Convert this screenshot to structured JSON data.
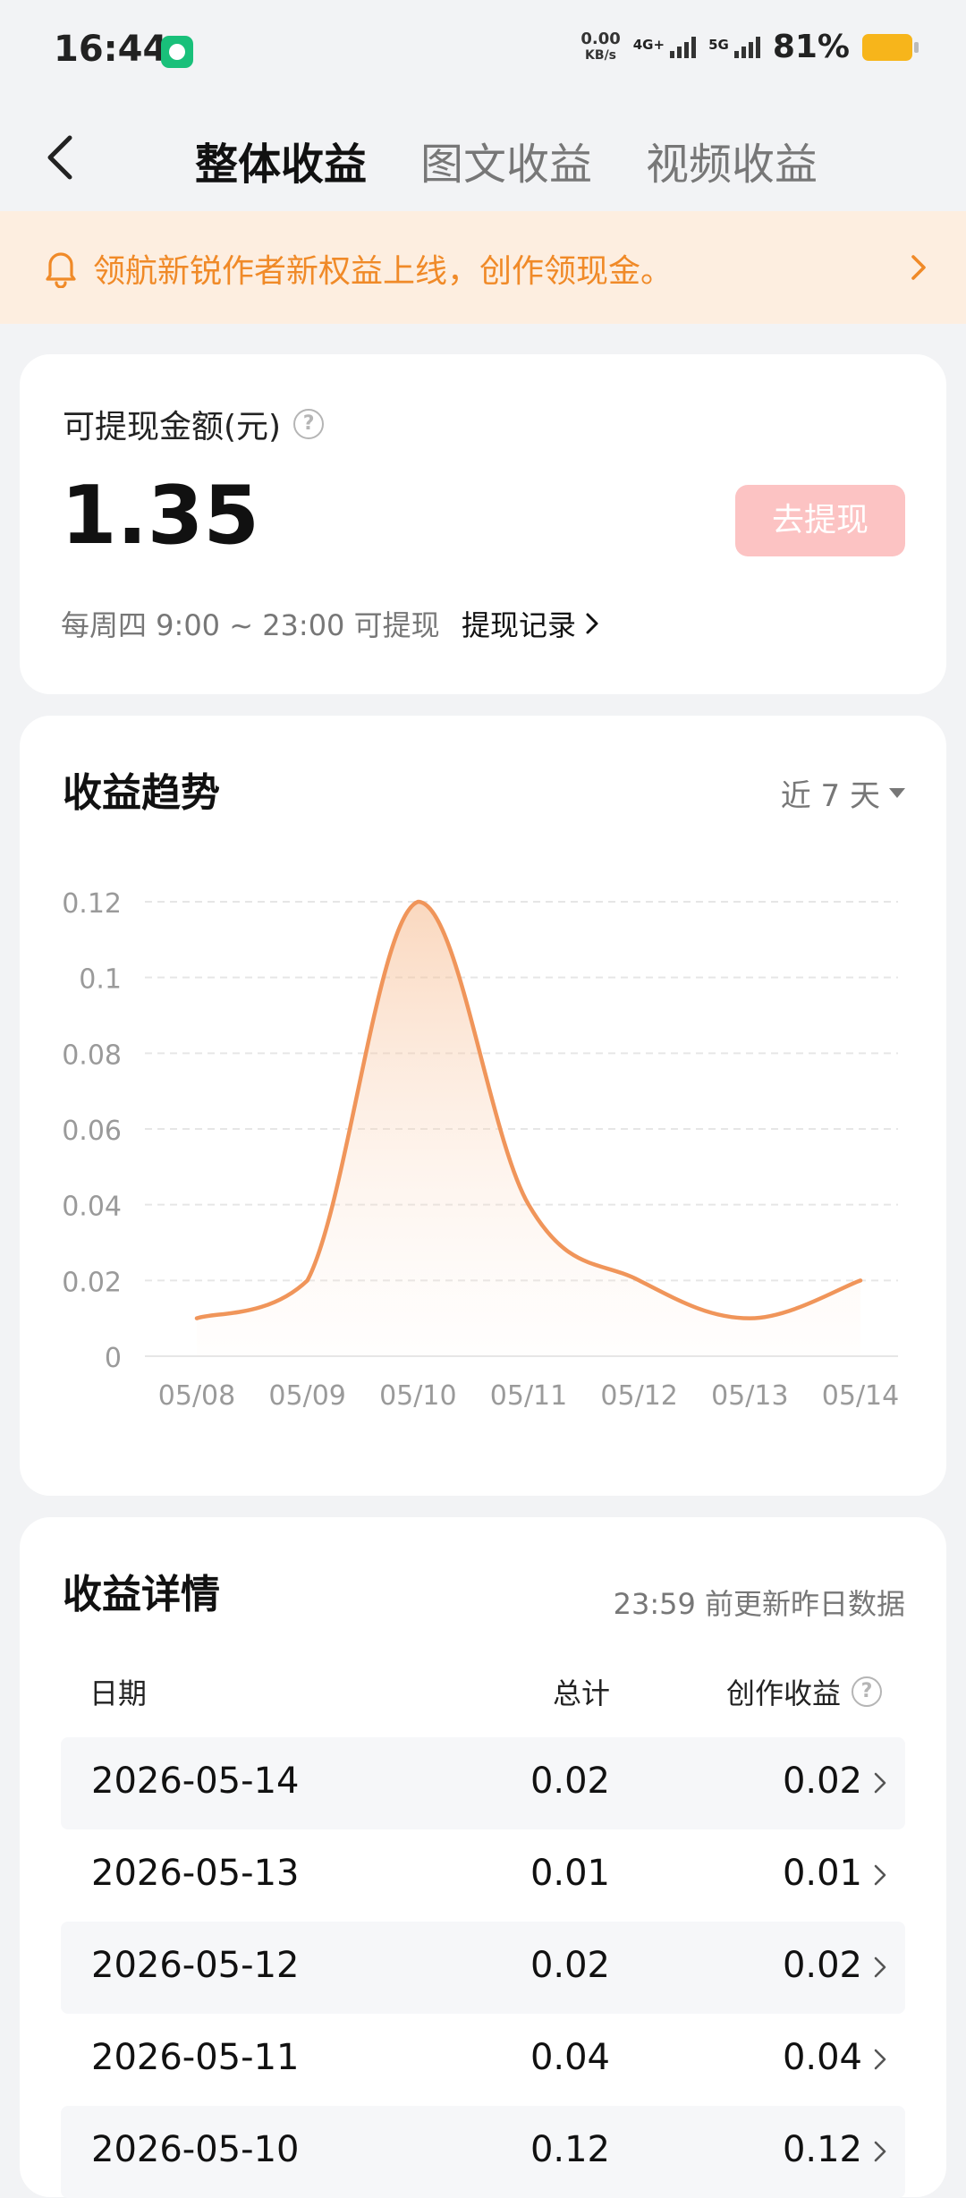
{
  "status_bar": {
    "time": "16:44",
    "net_speed_value": "0.00",
    "net_speed_unit": "KB/s",
    "sig1_label": "4G+",
    "sig2_label": "5G",
    "battery": "81%"
  },
  "nav": {
    "tabs": [
      {
        "label": "整体收益",
        "active": true
      },
      {
        "label": "图文收益"
      },
      {
        "label": "视频收益"
      }
    ]
  },
  "banner": {
    "text": "领航新锐作者新权益上线，创作领现金。"
  },
  "balance": {
    "label": "可提现金额(元)",
    "amount": "1.35",
    "withdraw_button": "去提现",
    "schedule": "每周四 9:00 ~ 23:00 可提现",
    "history_link": "提现记录"
  },
  "trend": {
    "title": "收益趋势",
    "period": "近 7 天"
  },
  "chart_data": {
    "type": "area",
    "categories": [
      "05/08",
      "05/09",
      "05/10",
      "05/11",
      "05/12",
      "05/13",
      "05/14"
    ],
    "values": [
      0.01,
      0.02,
      0.12,
      0.04,
      0.02,
      0.01,
      0.02
    ],
    "yticks": [
      "0.12",
      "0.1",
      "0.08",
      "0.06",
      "0.04",
      "0.02",
      "0"
    ],
    "ylim": [
      0,
      0.12
    ],
    "grid": true,
    "line_color": "#f0955a"
  },
  "details": {
    "title": "收益详情",
    "note": "23:59 前更新昨日数据",
    "headers": {
      "date": "日期",
      "total": "总计",
      "creation": "创作收益"
    },
    "rows": [
      {
        "date": "2026-05-14",
        "total": "0.02",
        "creation": "0.02"
      },
      {
        "date": "2026-05-13",
        "total": "0.01",
        "creation": "0.01"
      },
      {
        "date": "2026-05-12",
        "total": "0.02",
        "creation": "0.02"
      },
      {
        "date": "2026-05-11",
        "total": "0.04",
        "creation": "0.04"
      },
      {
        "date": "2026-05-10",
        "total": "0.12",
        "creation": "0.12"
      }
    ]
  },
  "colors": {
    "accent_orange": "#f08a28",
    "banner_bg": "#fdeee0",
    "button_pink": "#fcc3c3"
  }
}
